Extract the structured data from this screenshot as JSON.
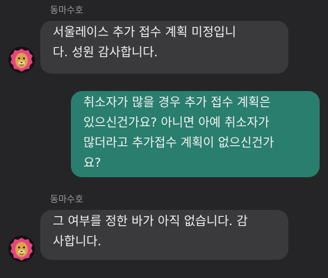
{
  "messages": [
    {
      "direction": "incoming",
      "sender": "동마수호",
      "text": "서울레이스 추가 접수 계획 미정입니\n다. 성원 감사합니다."
    },
    {
      "direction": "outgoing",
      "text": "취소자가 많을 경우 추가 접수 계획은\n있으신건가요? 아니면 아예 취소자가\n많더라고 추가접수 계획이 없으신건가\n요?"
    },
    {
      "direction": "incoming",
      "sender": "동마수호",
      "text": "그 여부를 정한 바가 아직 없습니다. 감\n사합니다."
    }
  ],
  "colors": {
    "background": "#252527",
    "incoming_bubble": "#3a3a3d",
    "outgoing_bubble": "#297e6e",
    "sender_name": "#9b9b9f",
    "text": "#f2f2f2"
  },
  "icons": {
    "avatar": "pink-lion-mascot-icon"
  }
}
